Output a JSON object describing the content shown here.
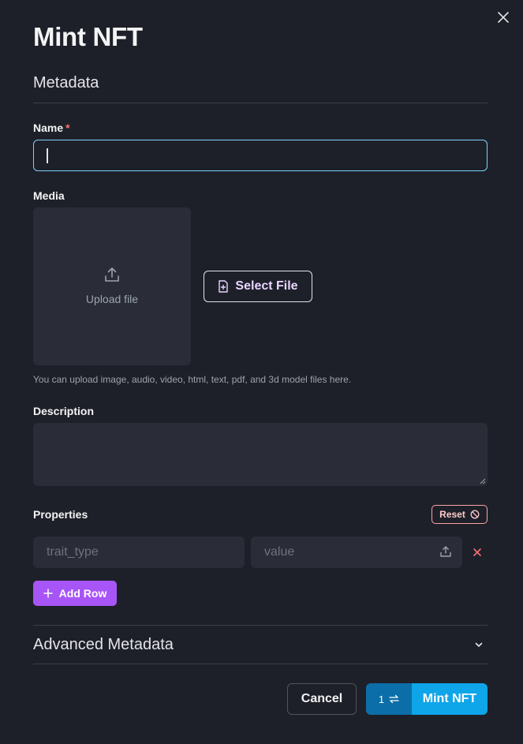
{
  "dialog": {
    "title": "Mint NFT",
    "close_icon": "close-icon"
  },
  "metadata": {
    "section_title": "Metadata",
    "name": {
      "label": "Name",
      "required_mark": "*",
      "value": ""
    },
    "media": {
      "label": "Media",
      "upload_text": "Upload file",
      "select_file_label": "Select File",
      "hint": "You can upload image, audio, video, html, text, pdf, and 3d model files here."
    },
    "description": {
      "label": "Description",
      "value": ""
    },
    "properties": {
      "label": "Properties",
      "reset_label": "Reset",
      "rows": [
        {
          "trait_placeholder": "trait_type",
          "value_placeholder": "value"
        }
      ],
      "add_row_label": "Add Row"
    }
  },
  "advanced": {
    "title": "Advanced Metadata"
  },
  "footer": {
    "cancel_label": "Cancel",
    "mint_count": "1",
    "mint_label": "Mint NFT"
  },
  "colors": {
    "background": "#1d2029",
    "accent_purple": "#a855f7",
    "accent_blue": "#0ea5e9",
    "focus_border": "#7dd3fc",
    "danger": "#f87171"
  }
}
